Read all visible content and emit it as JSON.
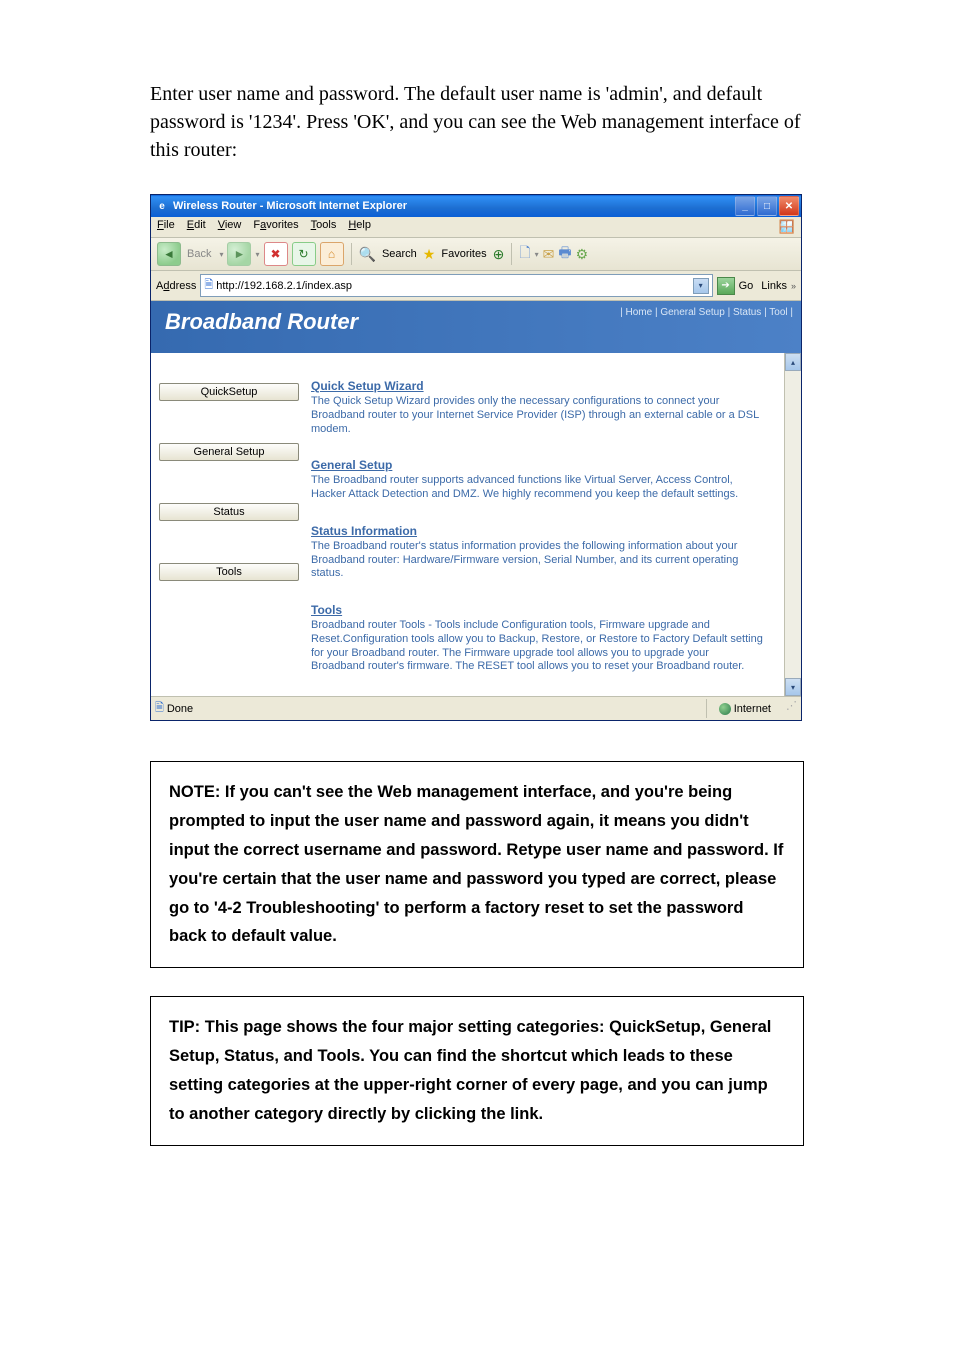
{
  "intro": "Enter user name and password. The default user name is 'admin', and default password is '1234'. Press 'OK', and you can see the Web management interface of this router:",
  "browser": {
    "title": "Wireless Router - Microsoft Internet Explorer",
    "menus": {
      "file": "File",
      "edit": "Edit",
      "view": "View",
      "favorites": "Favorites",
      "tools": "Tools",
      "help": "Help"
    },
    "toolbar": {
      "back": "Back",
      "search": "Search",
      "favorites": "Favorites"
    },
    "address": {
      "label": "Address",
      "url": "http://192.168.2.1/index.asp",
      "go": "Go",
      "links": "Links"
    },
    "status": {
      "done": "Done",
      "zone": "Internet"
    }
  },
  "router": {
    "title": "Broadband Router",
    "nav": "| Home | General Setup | Status | Tool |",
    "buttons": {
      "quick": "QuickSetup",
      "general": "General Setup",
      "status": "Status",
      "tools": "Tools"
    },
    "sections": {
      "quick": {
        "title": "Quick Setup Wizard",
        "text": "The Quick Setup Wizard provides only the necessary configurations to connect your Broadband router to your Internet Service Provider (ISP) through an external cable or a DSL modem."
      },
      "general": {
        "title": "General Setup",
        "text": "The Broadband router supports advanced functions like Virtual Server, Access Control, Hacker Attack Detection and DMZ. We highly recommend you keep the default settings."
      },
      "status": {
        "title": "Status Information",
        "text": "The Broadband router's status information provides the following information about your Broadband router: Hardware/Firmware version, Serial Number, and its current operating status."
      },
      "tools": {
        "title": "Tools",
        "text": "Broadband router Tools - Tools include Configuration tools, Firmware upgrade and Reset.Configuration tools allow you to Backup, Restore, or Restore to Factory Default setting for your Broadband router. The Firmware upgrade tool allows you to upgrade your Broadband router's firmware. The RESET tool allows you to reset your Broadband router."
      }
    }
  },
  "note": "NOTE: If you can't see the Web management interface, and you're being prompted to input the user name and password again, it means you didn't input the correct username and password. Retype user name and password. If you're certain that the user name and password you typed are correct, please go to '4-2 Troubleshooting' to perform a factory reset to set the password back to default value.",
  "tip": "TIP: This page shows the four major setting categories: QuickSetup, General Setup, Status, and Tools. You can find the shortcut which leads to these setting categories at the upper-right corner of every page, and you can jump to another category directly by clicking the link."
}
